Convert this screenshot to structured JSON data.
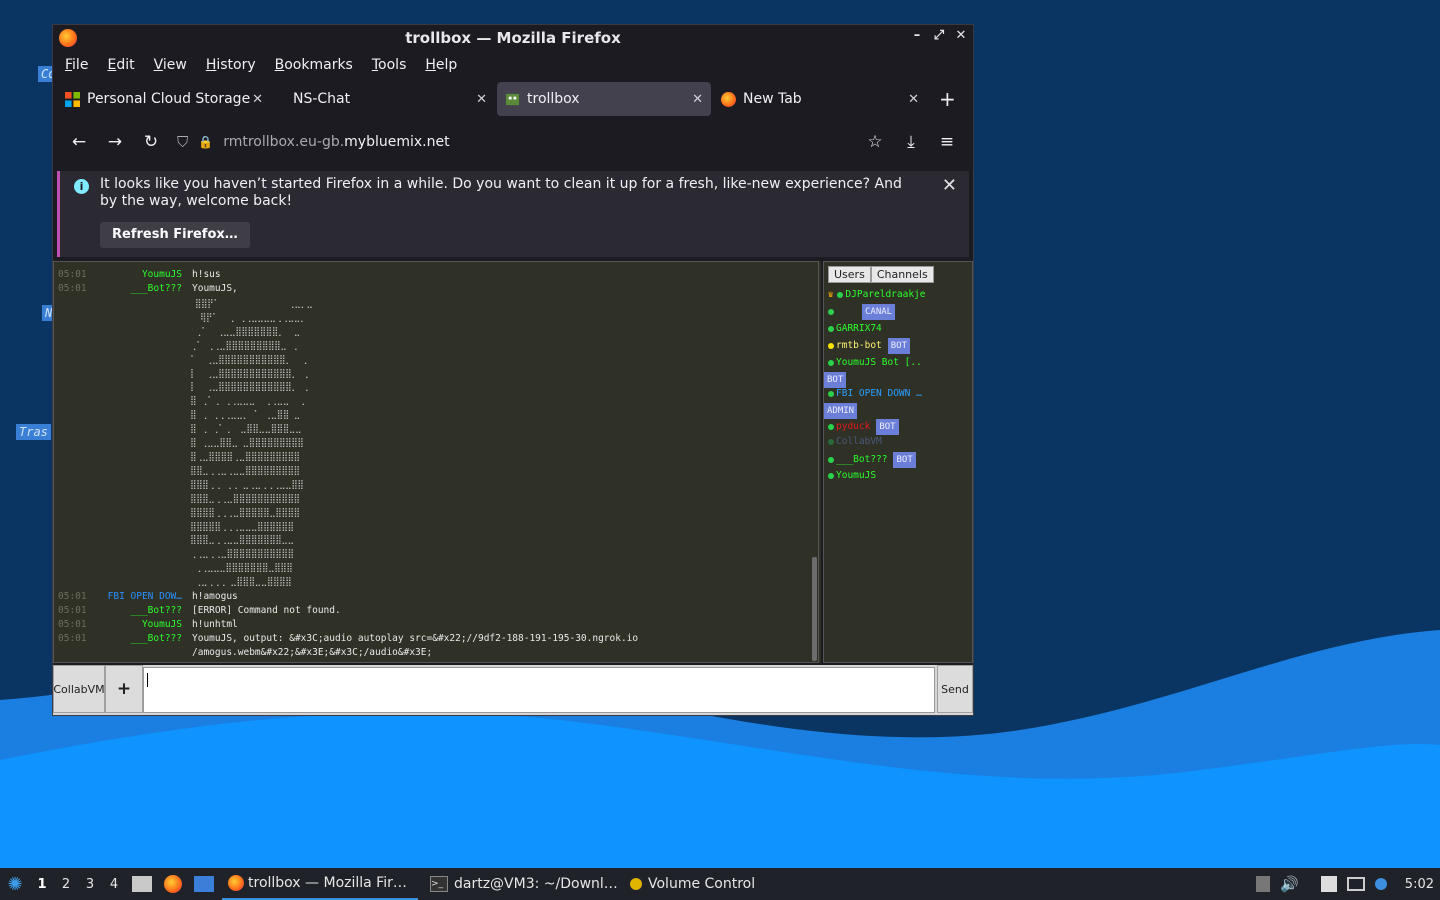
{
  "window": {
    "title": "trollbox — Mozilla Firefox"
  },
  "menu": [
    "File",
    "Edit",
    "View",
    "History",
    "Bookmarks",
    "Tools",
    "Help"
  ],
  "tabs": [
    {
      "label": "Personal Cloud Storage"
    },
    {
      "label": "NS-Chat"
    },
    {
      "label": "trollbox"
    },
    {
      "label": "New Tab"
    }
  ],
  "url": {
    "prefix": "rmtrollbox.eu-gb.",
    "host": "mybluemix.net"
  },
  "notification": {
    "message": "It looks like you haven’t started Firefox in a while. Do you want to clean it up for a fresh, like-new experience? And by the way, welcome back!",
    "button": "Refresh Firefox…"
  },
  "chat": {
    "messages": [
      {
        "time": "05:01",
        "nick": "YoumuJS",
        "text": "h!sus"
      },
      {
        "time": "05:01",
        "nick": "___Bot???",
        "text": "YoumuJS,"
      },
      {
        "time": "05:01",
        "nick": "FBI OPEN DOW…",
        "text": "h!amogus"
      },
      {
        "time": "05:01",
        "nick": "___Bot???",
        "text": "[ERROR] Command not found."
      },
      {
        "time": "05:01",
        "nick": "YoumuJS",
        "text": "h!unhtml"
      },
      {
        "time": "05:01",
        "nick": "___Bot???",
        "text": "YoumuJS, output: &#x3C;audio autoplay src=&#x22;//9df2-188-191-195-30.ngrok.io"
      },
      {
        "time": "",
        "nick": "",
        "text": "/amogus.webm&#x22;&#x3E;&#x3C;/audio&#x3E;"
      }
    ]
  },
  "sidebar": {
    "tabs": [
      "Users",
      "Channels"
    ],
    "users": [
      {
        "name": "DJPareldraakje",
        "badge": ""
      },
      {
        "name": "",
        "badge": "CANAL"
      },
      {
        "name": "GARRIX74",
        "badge": ""
      },
      {
        "name": "rmtb-bot",
        "badge": "BOT"
      },
      {
        "name": "YoumuJS Bot [..",
        "badge": ""
      },
      {
        "name": "",
        "badge": "BOT"
      },
      {
        "name": "FBI OPEN DOWN …",
        "badge": ""
      },
      {
        "name": "",
        "badge": "ADMIN"
      },
      {
        "name": "pyduck",
        "badge": "BOT"
      },
      {
        "name": "CollabVM",
        "badge": ""
      },
      {
        "name": "___Bot???",
        "badge": "BOT"
      },
      {
        "name": "YoumuJS",
        "badge": ""
      }
    ]
  },
  "bottom": {
    "left_button": "CollabVM",
    "plus": "+",
    "send": "Send"
  },
  "taskbar": {
    "workspaces": [
      "1",
      "2",
      "3",
      "4"
    ],
    "tasks": [
      "trollbox — Mozilla Fir…",
      "dartz@VM3: ~/Downl…",
      "Volume Control"
    ],
    "clock": "5:02"
  },
  "desktop_icons": [
    "Co",
    "N",
    "Tras"
  ]
}
